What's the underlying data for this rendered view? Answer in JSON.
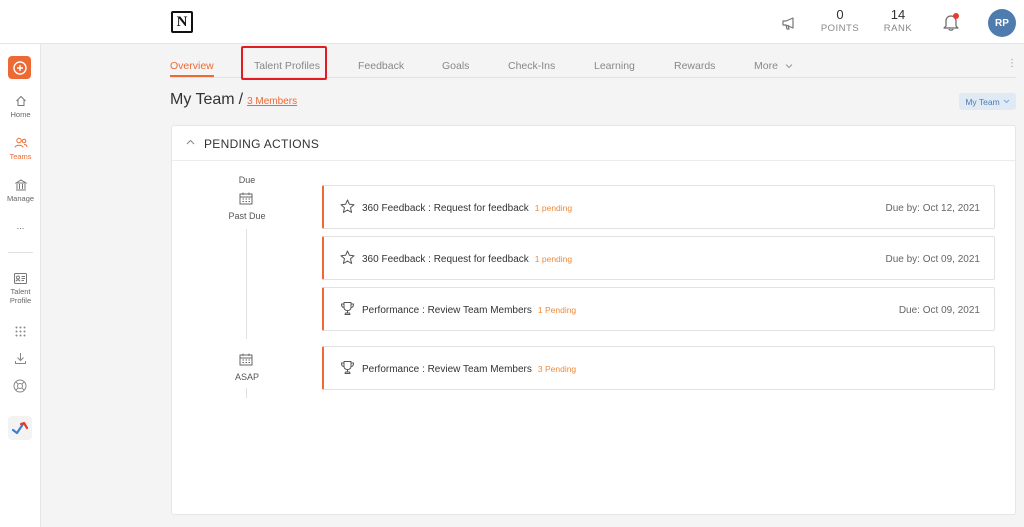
{
  "app": {
    "logo_letter": "N",
    "brand_color": "#ee6a35",
    "highlight_color": "#e31b23"
  },
  "topbar": {
    "points_value": "0",
    "points_label": "POINTS",
    "rank_value": "14",
    "rank_label": "RANK",
    "avatar_initials": "RP",
    "icons": [
      "megaphone-icon",
      "bell-icon"
    ]
  },
  "sidebar": {
    "items": [
      {
        "label": "Home",
        "icon": "home-icon"
      },
      {
        "label": "Teams",
        "icon": "teams-icon"
      },
      {
        "label": "Manage",
        "icon": "manage-icon"
      },
      {
        "label": "...",
        "icon": "more-dots-icon"
      },
      {
        "label": "Talent Profile",
        "icon": "talent-profile-icon"
      }
    ]
  },
  "tabs": [
    {
      "label": "Overview"
    },
    {
      "label": "Talent Profiles"
    },
    {
      "label": "Feedback"
    },
    {
      "label": "Goals"
    },
    {
      "label": "Check-Ins"
    },
    {
      "label": "Learning"
    },
    {
      "label": "Rewards"
    },
    {
      "label": "More"
    }
  ],
  "header": {
    "title": "My Team",
    "separator": "/",
    "members_link": "3 Members",
    "team_select": "My Team"
  },
  "pending": {
    "title": "PENDING ACTIONS",
    "due_label": "Due",
    "past_due_label": "Past Due",
    "asap_label": "ASAP",
    "items": [
      {
        "title": "360 Feedback : Request for feedback",
        "pending": "1 pending",
        "due": "Due by: Oct 12, 2021",
        "icon": "star-icon"
      },
      {
        "title": "360 Feedback : Request for feedback",
        "pending": "1 pending",
        "due": "Due by: Oct 09, 2021",
        "icon": "star-icon"
      },
      {
        "title": "Performance : Review Team Members",
        "pending": "1 Pending",
        "due": "Due: Oct 09, 2021",
        "icon": "trophy-icon"
      },
      {
        "title": "Performance : Review Team Members",
        "pending": "3 Pending",
        "due": "",
        "icon": "trophy-icon"
      }
    ]
  }
}
